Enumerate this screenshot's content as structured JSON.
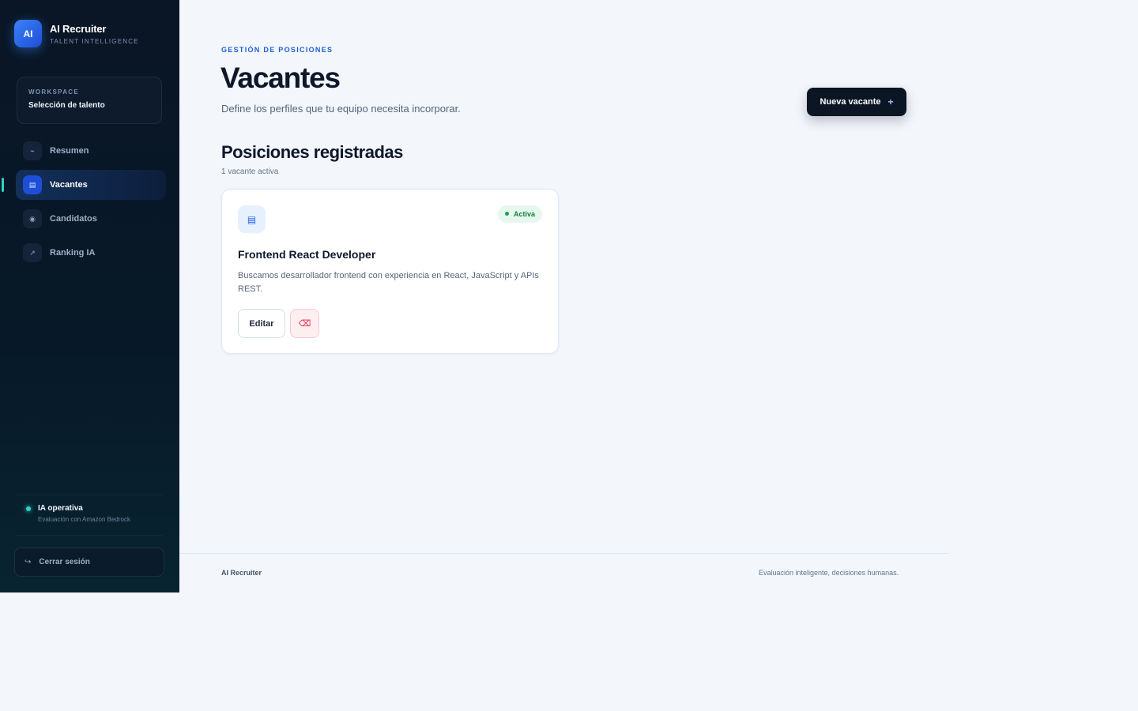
{
  "brand": {
    "logo_text": "AI",
    "name": "AI Recruiter",
    "tagline": "TALENT INTELLIGENCE"
  },
  "workspace": {
    "label": "WORKSPACE",
    "value": "Selección de talento"
  },
  "nav": {
    "items": [
      {
        "label": "Resumen",
        "icon": "⌁",
        "icon_name": "summary-icon",
        "active": false
      },
      {
        "label": "Vacantes",
        "icon": "▤",
        "icon_name": "list-icon",
        "active": true
      },
      {
        "label": "Candidatos",
        "icon": "◉",
        "icon_name": "candidates-icon",
        "active": false
      },
      {
        "label": "Ranking IA",
        "icon": "↗",
        "icon_name": "trend-icon",
        "active": false
      }
    ]
  },
  "ia_status": {
    "title": "IA operativa",
    "subtitle": "Evaluación con Amazon Bedrock"
  },
  "logout": {
    "icon": "↪",
    "label": "Cerrar sesión"
  },
  "header": {
    "eyebrow": "GESTIÓN DE POSICIONES",
    "title": "Vacantes",
    "subtitle": "Define los perfiles que tu equipo necesita incorporar.",
    "new_button": "Nueva vacante",
    "new_button_icon": "+"
  },
  "section": {
    "title": "Posiciones registradas",
    "count": "1 vacante activa"
  },
  "vacancies": [
    {
      "icon": "▤",
      "status": "Activa",
      "title": "Frontend React Developer",
      "description": "Buscamos desarrollador frontend con experiencia en React, JavaScript y APIs REST.",
      "edit_label": "Editar",
      "delete_icon": "⌫"
    }
  ],
  "footer": {
    "left": "AI Recruiter",
    "right": "Evaluación inteligente, decisiones humanas."
  },
  "colors": {
    "sidebar_bg": "#0a1626",
    "accent": "#1d4ed8",
    "active_indicator": "#2dd4bf",
    "status_green": "#16a34a",
    "danger": "#e11d48",
    "page_bg": "#f3f6fb"
  }
}
